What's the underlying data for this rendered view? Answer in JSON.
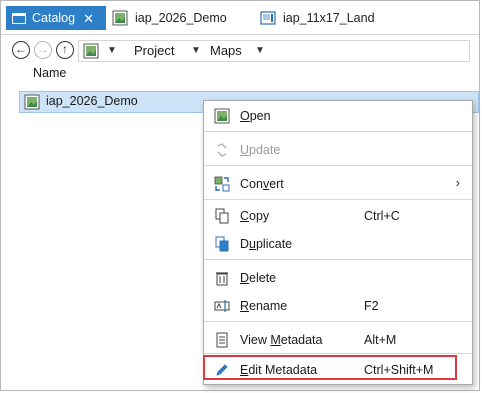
{
  "tabs": [
    {
      "label": "Catalog",
      "active": true,
      "close": "✕"
    },
    {
      "label": "iap_2026_Demo",
      "active": false
    },
    {
      "label": "iap_11x17_Land",
      "active": false
    }
  ],
  "breadcrumb": {
    "items": [
      "Project",
      "Maps"
    ]
  },
  "columns": {
    "name": "Name"
  },
  "selected_item": {
    "label": "iap_2026_Demo"
  },
  "context_menu": {
    "open": {
      "pre": "",
      "u": "O",
      "post": "pen"
    },
    "update": {
      "pre": "",
      "u": "U",
      "post": "pdate"
    },
    "convert": {
      "pre": "Con",
      "u": "v",
      "post": "ert",
      "arrow": "›"
    },
    "copy": {
      "pre": "",
      "u": "C",
      "post": "opy",
      "shortcut": "Ctrl+C"
    },
    "duplicate": {
      "pre": "D",
      "u": "u",
      "post": "plicate"
    },
    "delete": {
      "pre": "",
      "u": "D",
      "post": "elete"
    },
    "rename": {
      "pre": "",
      "u": "R",
      "post": "ename",
      "shortcut": "F2"
    },
    "view_metadata": {
      "pre": "View ",
      "u": "M",
      "post": "etadata",
      "shortcut": "Alt+M"
    },
    "edit_metadata": {
      "pre": "",
      "u": "E",
      "post": "dit Metadata",
      "shortcut": "Ctrl+Shift+M"
    }
  },
  "colors": {
    "tab_active": "#2d7fc7",
    "selection": "#cde3f7",
    "highlight": "#e0373c"
  }
}
